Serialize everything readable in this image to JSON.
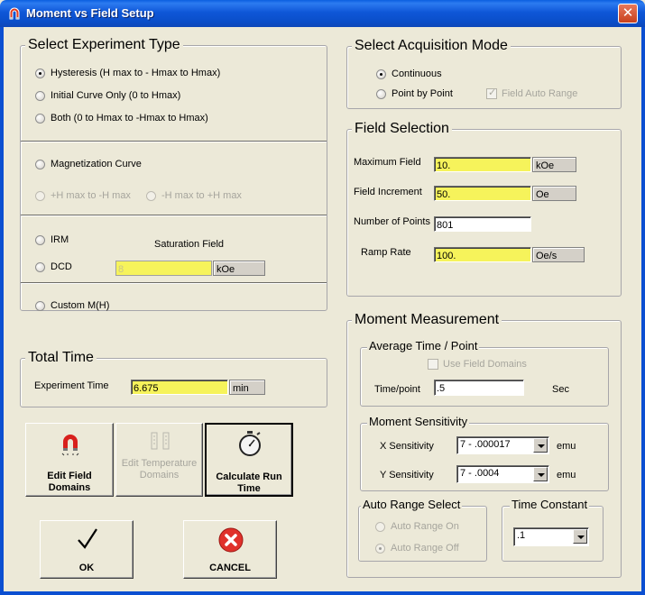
{
  "window": {
    "title": "Moment vs Field Setup",
    "close_glyph": "✕"
  },
  "experiment_type": {
    "title": "Select Experiment Type",
    "hysteresis": "Hysteresis (H max to - Hmax to Hmax)",
    "initial_curve": "Initial Curve Only (0 to Hmax)",
    "both": "Both (0 to Hmax to -Hmax to Hmax)",
    "magnetization": "Magnetization Curve",
    "pos_to_neg": "+H max to -H max",
    "neg_to_pos": "-H max to +H max",
    "irm": "IRM",
    "dcd": "DCD",
    "saturation_label": "Saturation Field",
    "saturation_value": "8",
    "saturation_unit": "kOe",
    "custom": "Custom M(H)"
  },
  "total_time": {
    "title": "Total Time",
    "label": "Experiment Time",
    "value": "6.675",
    "unit": "min"
  },
  "buttons": {
    "edit_field_domains": "Edit Field Domains",
    "edit_temperature_domains": "Edit Temperature Domains",
    "calculate_run_time": "Calculate Run Time",
    "ok": "OK",
    "cancel": "CANCEL"
  },
  "acquisition": {
    "title": "Select Acquisition Mode",
    "continuous": "Continuous",
    "point_by_point": "Point by Point",
    "field_auto_range": "Field Auto Range"
  },
  "field_selection": {
    "title": "Field Selection",
    "max_label": "Maximum Field",
    "max_value": "10.",
    "max_unit": "kOe",
    "inc_label": "Field Increment",
    "inc_value": "50.",
    "inc_unit": "Oe",
    "points_label": "Number of Points",
    "points_value": "801",
    "ramp_label": "Ramp Rate",
    "ramp_value": "100.",
    "ramp_unit": "Oe/s"
  },
  "moment": {
    "title": "Moment Measurement",
    "avg_title": "Average Time / Point",
    "use_field_domains": "Use Field Domains",
    "time_label": "Time/point",
    "time_value": ".5",
    "time_unit": "Sec",
    "sens_title": "Moment Sensitivity",
    "x_label": "X Sensitivity",
    "x_value": "7 - .000017",
    "x_unit": "emu",
    "y_label": "Y Sensitivity",
    "y_value": "7 - .0004",
    "y_unit": "emu",
    "auto_range_title": "Auto Range Select",
    "auto_on": "Auto Range On",
    "auto_off": "Auto Range Off",
    "time_constant_title": "Time Constant",
    "time_constant_value": ".1"
  },
  "colors": {
    "title_bar": "#0a4ec9",
    "highlight_field": "#f6f35b",
    "dialog_bg": "#ece9d8",
    "cancel_red": "#e0312b"
  }
}
